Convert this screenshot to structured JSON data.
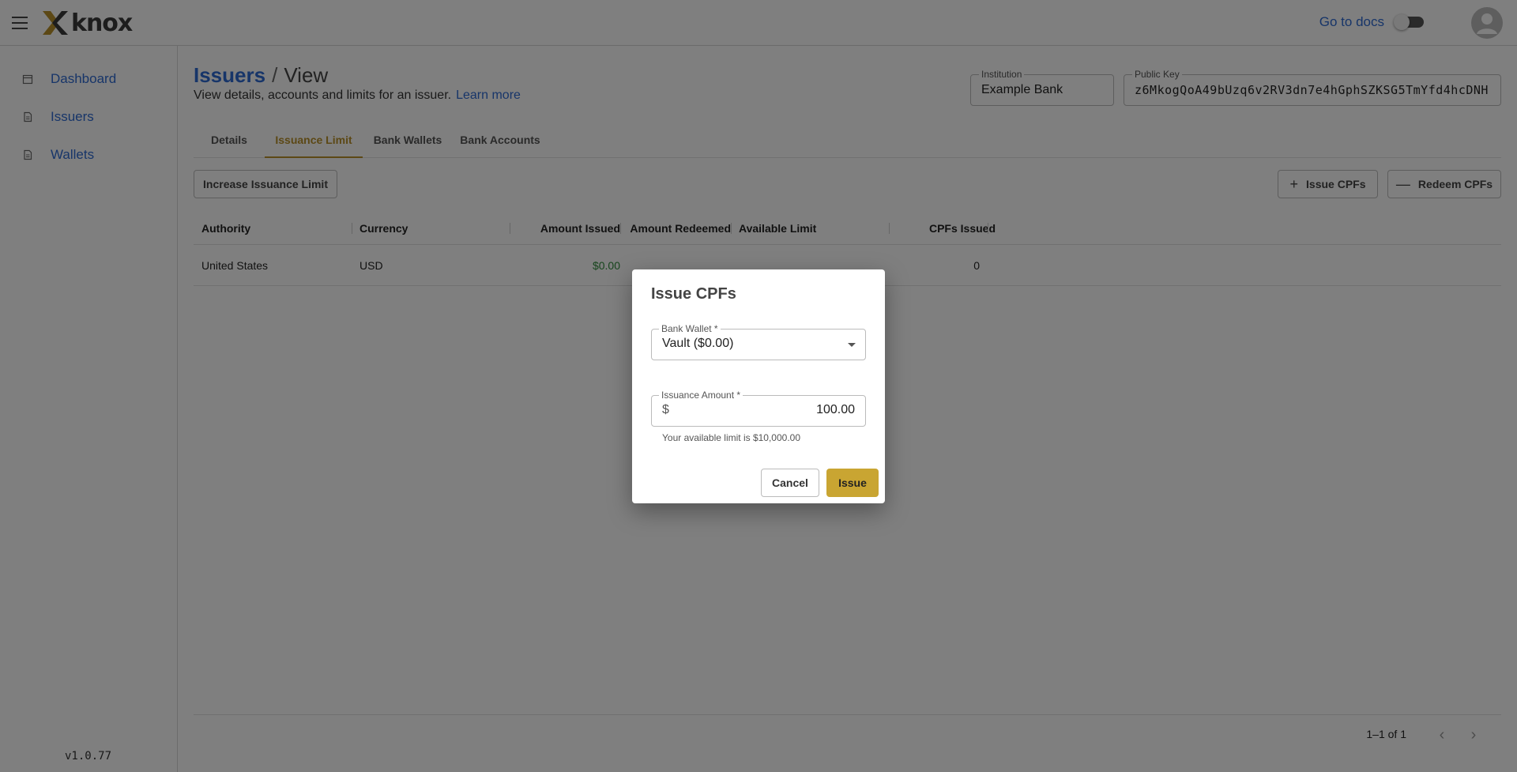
{
  "app": {
    "logo_text": "knox",
    "docs_link": "Go to docs",
    "version": "v1.0.77"
  },
  "sidebar": {
    "items": [
      {
        "label": "Dashboard",
        "icon": "calendar-icon"
      },
      {
        "label": "Issuers",
        "icon": "document-icon"
      },
      {
        "label": "Wallets",
        "icon": "document-icon"
      }
    ]
  },
  "page": {
    "breadcrumb_parent": "Issuers",
    "breadcrumb_sep": "/",
    "breadcrumb_current": "View",
    "subtitle": "View details, accounts and limits for an issuer.",
    "learn_more": "Learn more",
    "institution_label": "Institution",
    "institution_value": "Example Bank",
    "public_key_label": "Public Key",
    "public_key_value": "z6MkogQoA49bUzq6v2RV3dn7e4hGphSZKSG5TmYfd4hcDNH"
  },
  "tabs": [
    "Details",
    "Issuance Limit",
    "Bank Wallets",
    "Bank Accounts"
  ],
  "active_tab": "Issuance Limit",
  "toolbar": {
    "increase_label": "Increase Issuance Limit",
    "issue_label": "Issue CPFs",
    "redeem_label": "Redeem CPFs"
  },
  "table": {
    "columns": [
      "Authority",
      "Currency",
      "Amount Issued",
      "Amount Redeemed",
      "Available Limit",
      "CPFs Issued"
    ],
    "rows": [
      {
        "authority": "United States",
        "currency": "USD",
        "amount_issued": "$0.00",
        "amount_redeemed": "",
        "available_limit": "",
        "cpfs_issued": "0"
      }
    ],
    "pagination": "1–1 of 1"
  },
  "dialog": {
    "title": "Issue CPFs",
    "wallet_label": "Bank Wallet *",
    "wallet_value": "Vault ($0.00)",
    "amount_label": "Issuance Amount *",
    "amount_prefix": "$",
    "amount_value": "100.00",
    "helper_text": "Your available limit is $10,000.00",
    "cancel_label": "Cancel",
    "issue_label": "Issue"
  },
  "colors": {
    "link": "#2f6bd3",
    "accent": "#b8902a",
    "primary_button": "#c9a532",
    "positive": "#2e8b3a"
  }
}
